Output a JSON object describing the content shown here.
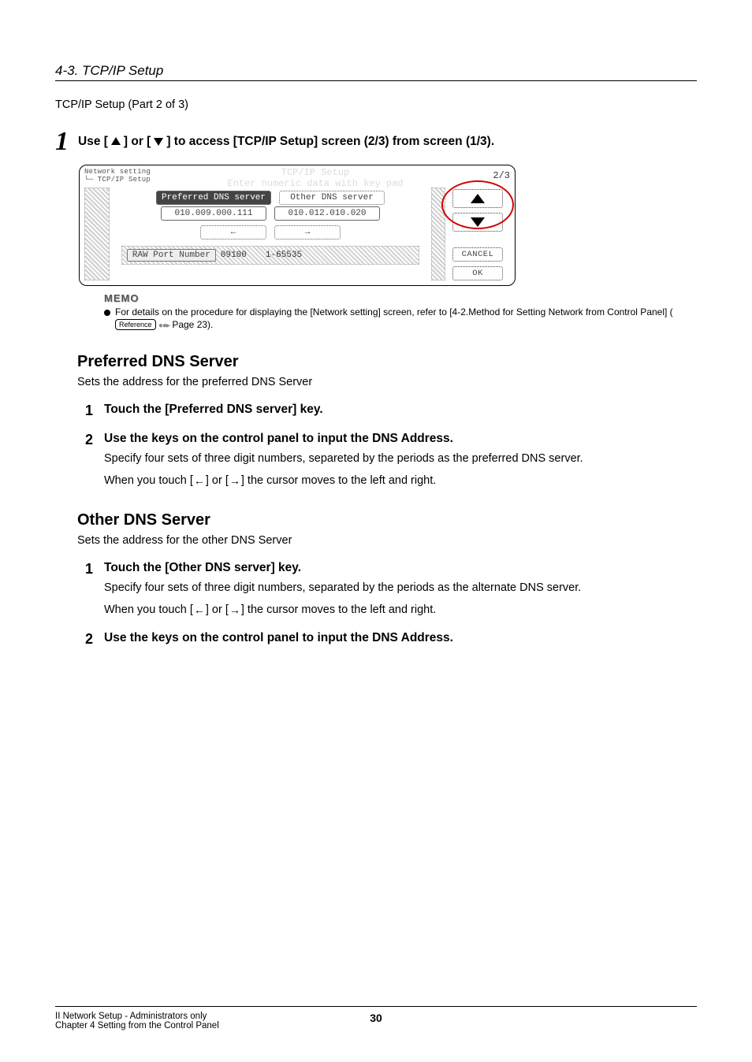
{
  "header": {
    "section": "4-3. TCP/IP Setup"
  },
  "part_label": "TCP/IP Setup (Part 2 of 3)",
  "step1": {
    "num": "1",
    "pre": "Use [",
    "mid": "] or [",
    "post": "] to access [TCP/IP Setup] screen (2/3) from screen (1/3)."
  },
  "terminal": {
    "breadcrumb_top": "Network setting",
    "breadcrumb_sub": "└─ TCP/IP Setup",
    "title_line1": "TCP/IP Setup",
    "title_line2": "Enter numeric data with key pad",
    "page_indicator": "2/3",
    "preferred_btn": "Preferred DNS server",
    "other_btn": "Other DNS server",
    "preferred_val": "010.009.000.111",
    "other_val": "010.012.010.020",
    "left_arrow": "←",
    "right_arrow": "→",
    "raw_label": "RAW Port Number",
    "raw_value": "09100",
    "raw_range": "1-65535",
    "cancel": "CANCEL",
    "ok": "OK"
  },
  "memo": {
    "title": "MEMO",
    "text_a": "For details on the procedure for displaying the [Network setting] screen, refer to [4-2.Method for Setting Network from Control Panel] (",
    "ref": "Reference",
    "text_b": " Page 23)."
  },
  "preferred": {
    "heading": "Preferred DNS Server",
    "desc": "Sets the address for the preferred DNS Server",
    "steps": [
      {
        "n": "1",
        "h": "Touch the [Preferred DNS server] key."
      },
      {
        "n": "2",
        "h": "Use the keys on the control panel to input the DNS Address.",
        "p1": "Specify four sets of three digit numbers, separeted by the periods as the preferred DNS server.",
        "p2a": "When you touch [",
        "p2b": "] or [",
        "p2c": "] the cursor moves to the left and right."
      }
    ]
  },
  "other": {
    "heading": "Other DNS Server",
    "desc": "Sets the address for the other DNS Server",
    "steps": [
      {
        "n": "1",
        "h": "Touch the [Other DNS server] key.",
        "p1": "Specify four sets of three digit numbers, separated by the periods as the alternate DNS server.",
        "p2a": "When you touch [",
        "p2b": "] or [",
        "p2c": "] the cursor moves to the left and right."
      },
      {
        "n": "2",
        "h": "Use the keys on the control panel to input the DNS Address."
      }
    ]
  },
  "footer": {
    "left1": "II Network Setup - Administrators only",
    "left2": "Chapter 4 Setting from the Control Panel",
    "page": "30"
  }
}
